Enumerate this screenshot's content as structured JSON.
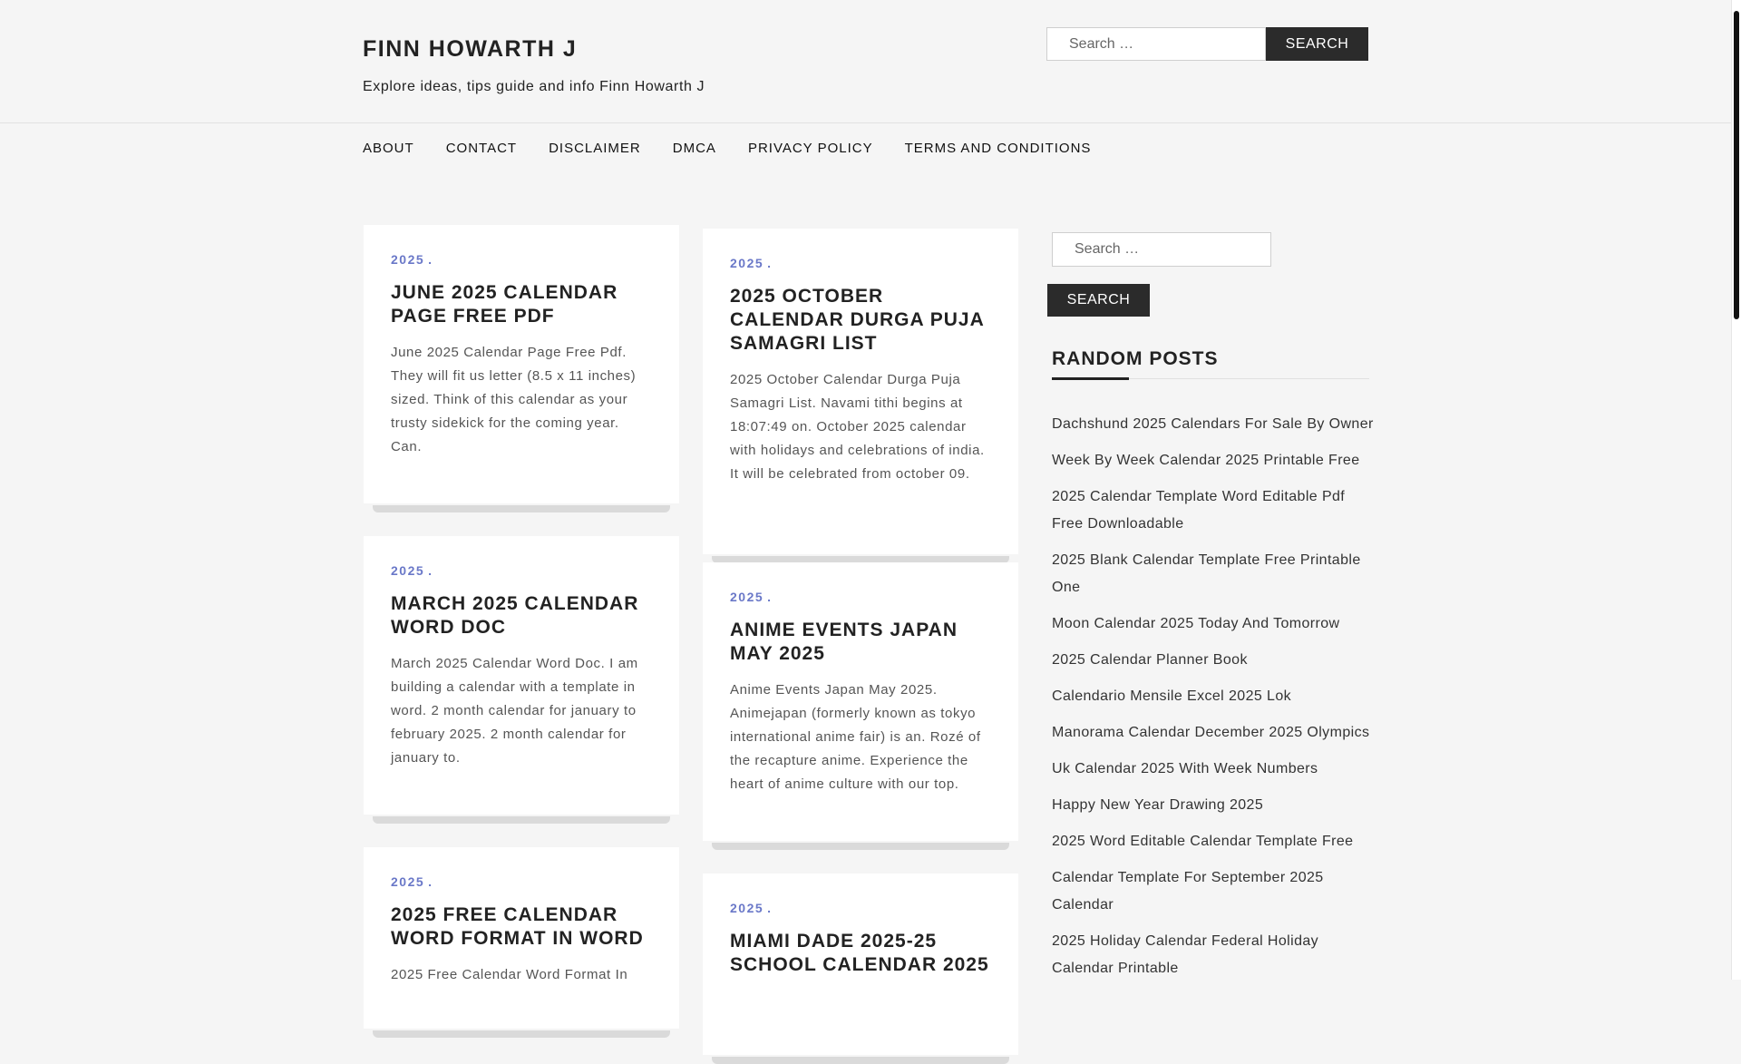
{
  "site": {
    "title": "FINN HOWARTH J",
    "description": "Explore ideas, tips guide and info Finn Howarth J"
  },
  "header_search": {
    "placeholder": "Search …",
    "button": "SEARCH"
  },
  "nav": [
    "ABOUT",
    "CONTACT",
    "DISCLAIMER",
    "DMCA",
    "PRIVACY POLICY",
    "TERMS AND CONDITIONS"
  ],
  "posts": [
    {
      "category": "2025",
      "title": "JUNE 2025 CALENDAR PAGE FREE PDF",
      "excerpt": "June 2025 Calendar Page Free Pdf. They will fit us letter (8.5 x 11 inches) sized. Think of this calendar as your trusty sidekick for the coming year. Can."
    },
    {
      "category": "2025",
      "title": "2025 OCTOBER CALENDAR DURGA PUJA SAMAGRI LIST",
      "excerpt": "2025 October Calendar Durga Puja Samagri List. Navami tithi begins at 18:07:49 on. October 2025 calendar with holidays and celebrations of india. It will be celebrated from october 09."
    },
    {
      "category": "2025",
      "title": "MARCH 2025 CALENDAR WORD DOC",
      "excerpt": "March 2025 Calendar Word Doc. I am building a calendar with a template in word. 2 month calendar for january to february 2025. 2 month calendar for january to."
    },
    {
      "category": "2025",
      "title": "ANIME EVENTS JAPAN MAY 2025",
      "excerpt": "Anime Events Japan May 2025. Animejapan (formerly known as tokyo international anime fair) is an. Rozé of the recapture anime. Experience the heart of anime culture with our top."
    },
    {
      "category": "2025",
      "title": "2025 FREE CALENDAR WORD FORMAT IN WORD",
      "excerpt": "2025 Free Calendar Word Format In"
    },
    {
      "category": "2025",
      "title": "MIAMI DADE 2025-25 SCHOOL CALENDAR 2025",
      "excerpt": ""
    }
  ],
  "sidebar": {
    "search_placeholder": "Search …",
    "search_button": "SEARCH",
    "random_title": "RANDOM POSTS",
    "random_posts": [
      "Dachshund 2025 Calendars For Sale By Owner",
      "Week By Week Calendar 2025 Printable Free",
      "2025 Calendar Template Word Editable Pdf Free Downloadable",
      "2025 Blank Calendar Template Free Printable One",
      "Moon Calendar 2025 Today And Tomorrow",
      "2025 Calendar Planner Book",
      "Calendario Mensile Excel 2025 Lok",
      "Manorama Calendar December 2025 Olympics",
      "Uk Calendar 2025 With Week Numbers",
      "Happy New Year Drawing 2025",
      "2025 Word Editable Calendar Template Free",
      "Calendar Template For September 2025 Calendar",
      "2025 Holiday Calendar Federal Holiday Calendar Printable"
    ]
  },
  "colors": {
    "accent": "#6a78c8",
    "button": "#2b2b2b",
    "background": "#f5f5f5"
  }
}
